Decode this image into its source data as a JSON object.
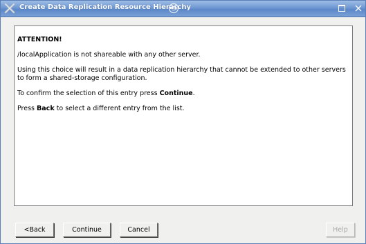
{
  "window": {
    "title": "Create Data Replication Resource Hierarchy"
  },
  "message": {
    "heading": "ATTENTION!",
    "line1": "/localApplication is not shareable with any other server.",
    "line2": "Using this choice will result in a data replication hierarchy that cannot be extended to other servers to form a shared-storage configuration.",
    "line3_prefix": "To confirm the selection of this entry press ",
    "line3_bold": "Continue",
    "line3_suffix": ".",
    "line4_prefix": "Press ",
    "line4_bold": "Back",
    "line4_suffix": " to select a different entry from the list."
  },
  "buttons": {
    "back": "<Back",
    "continue": "Continue",
    "cancel": "Cancel",
    "help": "Help"
  },
  "icons": {
    "app": "steeleye-x-icon",
    "swirl": "swirl-icon",
    "maximize": "maximize-icon",
    "close": "close-icon"
  },
  "colors": {
    "titlebar": "#6f98d2",
    "title_text": "#ffffff",
    "background": "#f0f0ee",
    "panel": "#ffffff",
    "disabled_text": "#a8a8a8"
  }
}
